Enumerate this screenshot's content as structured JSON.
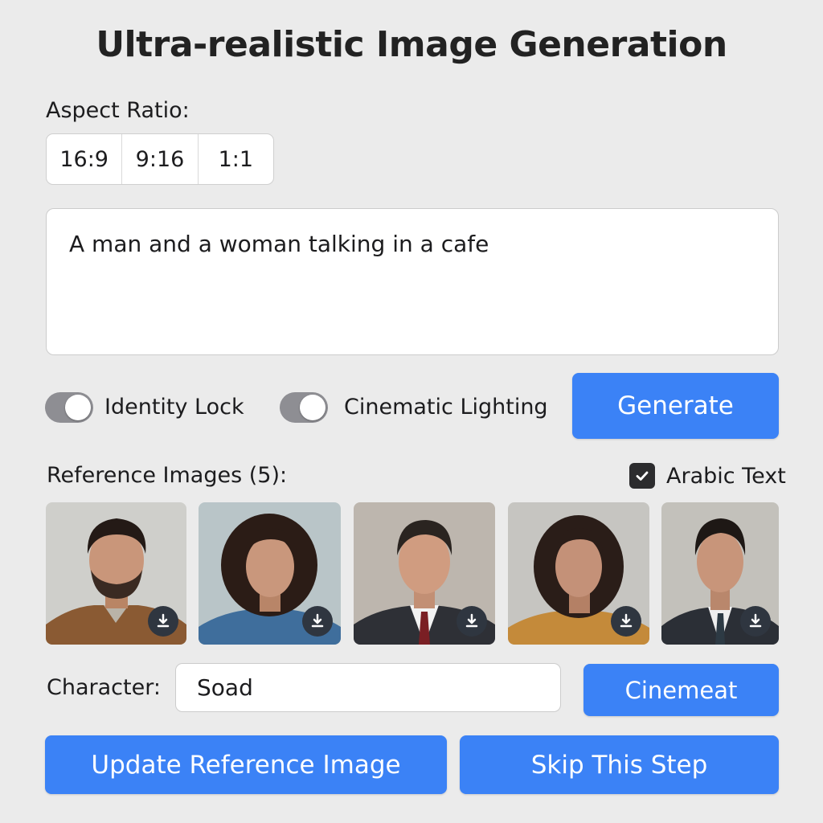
{
  "header": {
    "title": "Ultra-realistic Image Generation"
  },
  "aspect_ratio": {
    "label": "Aspect Ratio:",
    "options": [
      "16:9",
      "9:16",
      "1:1"
    ]
  },
  "prompt": {
    "value": "A man and a woman talking in a cafe"
  },
  "toggles": [
    {
      "label": "Identity Lock",
      "state": "on"
    },
    {
      "label": "Cinematic Lighting",
      "state": "on"
    }
  ],
  "generate_label": "Generate",
  "references": {
    "label": "Reference Images (5):",
    "arabic_text_label": "Arabic Text",
    "arabic_text_checked": true,
    "images": [
      {
        "subject": "man-beard-brown-shirt"
      },
      {
        "subject": "woman-curly-denim-shirt"
      },
      {
        "subject": "man-suit-red-tie"
      },
      {
        "subject": "woman-curly-mustard-sweater"
      },
      {
        "subject": "man-suit-dark-tie"
      }
    ]
  },
  "character": {
    "label": "Character:",
    "value": "Soad"
  },
  "cinemeat_label": "Cinemeat",
  "update_label": "Update Reference Image",
  "skip_label": "Skip This Step",
  "colors": {
    "accent": "#3b82f6",
    "toggle": "#8e8e93",
    "background": "#ebebeb"
  },
  "icons": {
    "download": "download-icon",
    "check": "check-icon"
  }
}
